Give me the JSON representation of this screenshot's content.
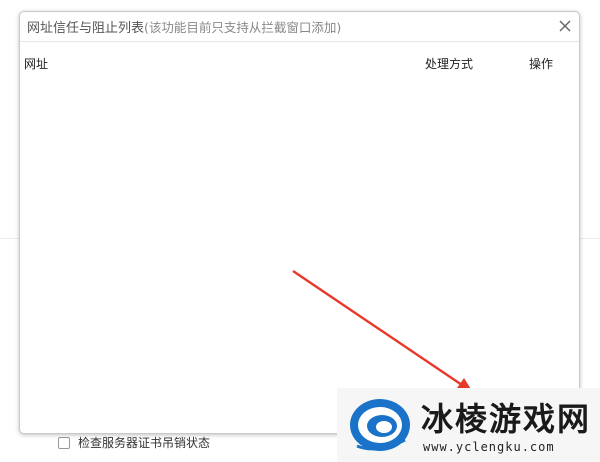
{
  "dialog": {
    "title": "网址信任与阻止列表",
    "title_hint": "(该功能目前只支持从拦截窗口添加)",
    "columns": {
      "url": "网址",
      "method": "处理方式",
      "action": "操作"
    },
    "rows": []
  },
  "background": {
    "checkbox_label": "检查服务器证书吊销状态",
    "checkbox_checked": false
  },
  "watermark": {
    "name": "冰棱游戏网",
    "url": "www.yclengku.com"
  },
  "colors": {
    "arrow": "#e8382a",
    "logo_blue": "#1a73c8"
  }
}
